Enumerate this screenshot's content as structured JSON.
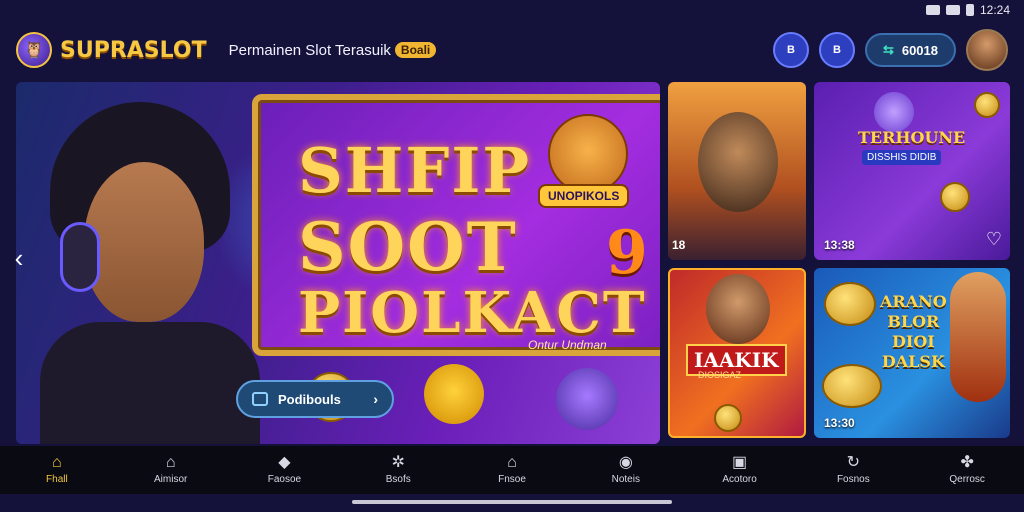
{
  "status_bar": {
    "time": "12:24"
  },
  "header": {
    "logo_text": "SUPRASLOT",
    "tagline": "Permainen Slot Terasuik",
    "tagline_badge": "Boali",
    "round_btn_1": "B",
    "round_btn_2": "B",
    "balance_label": "60018",
    "balance_arrow": "⇆"
  },
  "hero": {
    "line1": "SHFIP",
    "line2": "SOOT",
    "line3": "PIOLKACT",
    "number": "9",
    "badge": "UNOPIKOLS",
    "sub": "Ontur Undman",
    "button_label": "Podibouls",
    "button_chevron": "›",
    "nav_left": "‹"
  },
  "cards": [
    {
      "time": "18",
      "title": ""
    },
    {
      "time": "13:38",
      "title": "TERHOUNE",
      "sub": "DISSHIS DIDIB"
    },
    {
      "time": "",
      "title": "IAAKIK",
      "sub": "DIOSIGAZ"
    },
    {
      "time": "13:30",
      "title": "ARANO\nBLOR\nDIOI\nDALSK"
    }
  ],
  "bottom_nav": [
    {
      "label": "Fhall",
      "icon": "⌂",
      "active": true
    },
    {
      "label": "Aimisor",
      "icon": "⌂",
      "active": false
    },
    {
      "label": "Faosoe",
      "icon": "◆",
      "active": false
    },
    {
      "label": "Bsofs",
      "icon": "✲",
      "active": false
    },
    {
      "label": "Fnsoe",
      "icon": "⌂",
      "active": false
    },
    {
      "label": "Noteis",
      "icon": "◉",
      "active": false
    },
    {
      "label": "Acotoro",
      "icon": "▣",
      "active": false
    },
    {
      "label": "Fosnos",
      "icon": "↻",
      "active": false
    },
    {
      "label": "Qerrosc",
      "icon": "✤",
      "active": false
    }
  ],
  "colors": {
    "accent": "#f2c640",
    "bg": "#14123a",
    "nav_bg": "#0a0a12"
  }
}
